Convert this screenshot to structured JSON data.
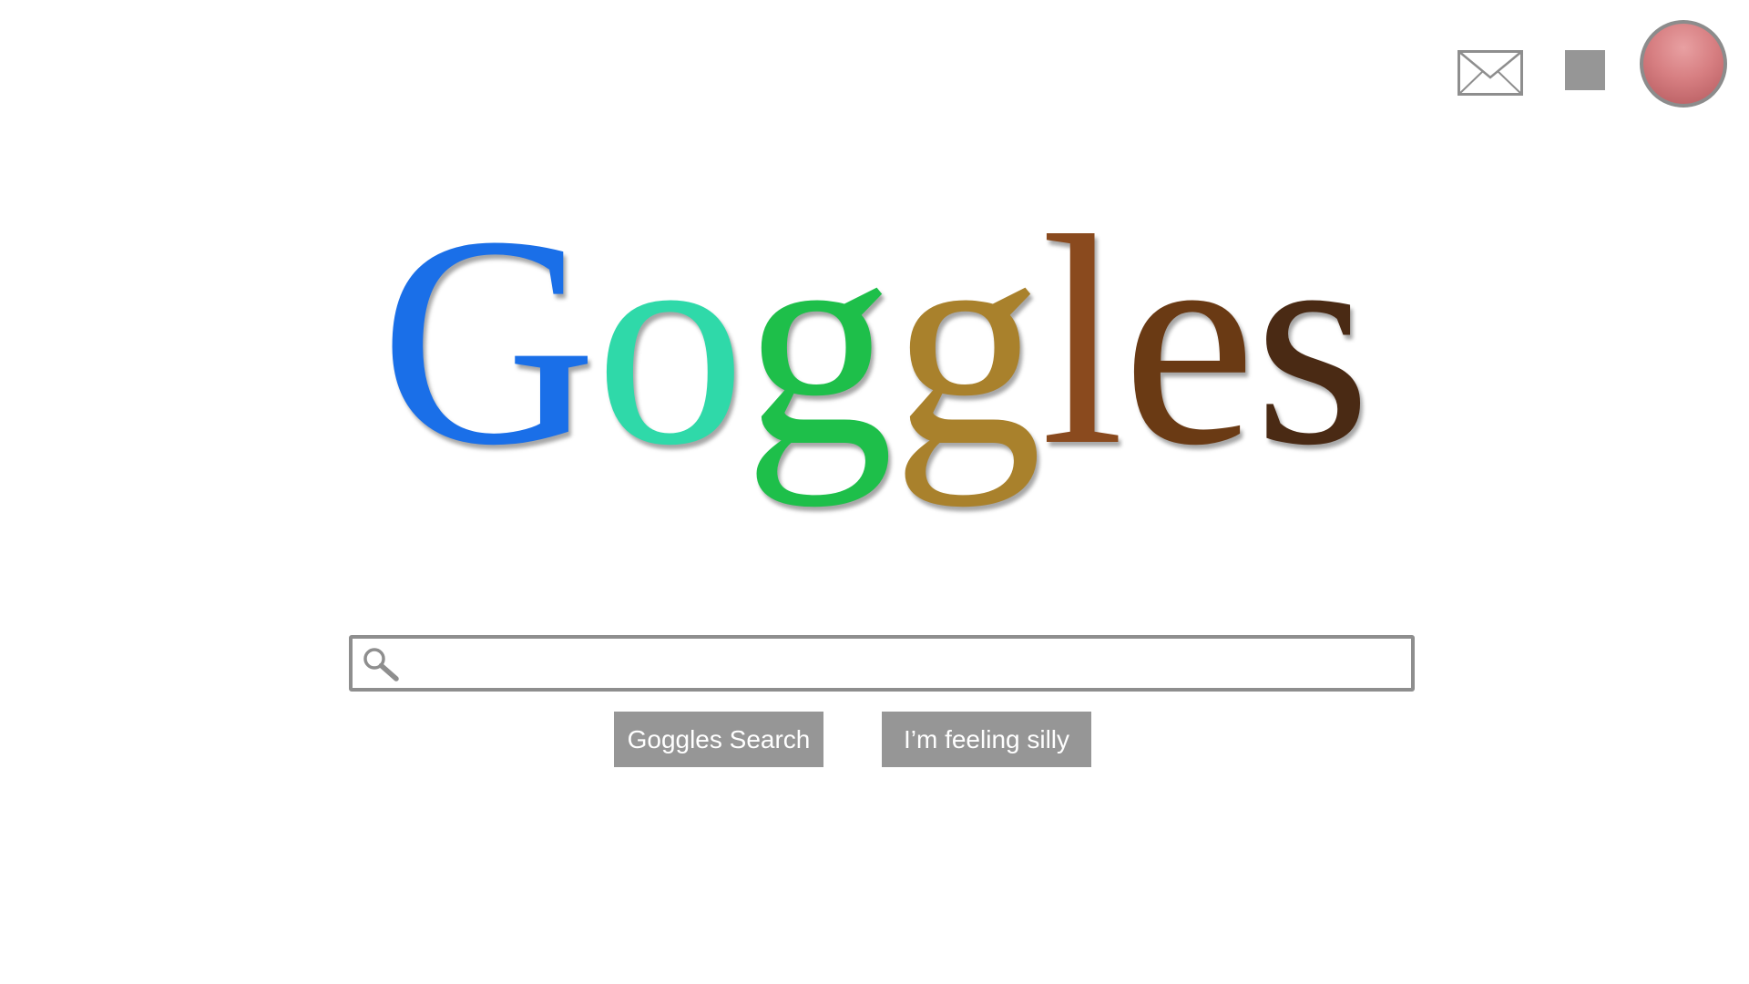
{
  "header": {
    "mail_icon": "envelope-icon",
    "apps_icon": "square-apps-icon",
    "avatar_color": "#d77f82"
  },
  "logo": {
    "letters": [
      "G",
      "o",
      "g",
      "g",
      "l",
      "e",
      "s"
    ],
    "colors": [
      "#1a6fe8",
      "#2fd9a9",
      "#1ebf4a",
      "#a9812c",
      "#8a4a1e",
      "#6a3a14",
      "#4a2a14"
    ]
  },
  "search": {
    "value": "",
    "placeholder": "",
    "icon": "magnifier-icon"
  },
  "buttons": {
    "search_label": "Goggles Search",
    "silly_label": "I’m feeling silly"
  }
}
